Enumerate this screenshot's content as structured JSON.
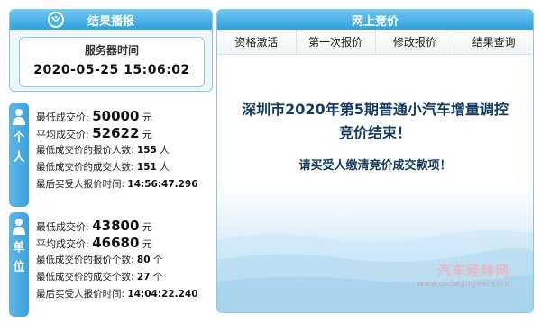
{
  "result_panel": {
    "title": "结果播报",
    "server_time_label": "服务器时间",
    "server_time": "2020-05-25 15:06:02"
  },
  "individual": {
    "tab_label": [
      "个",
      "人"
    ],
    "min_price_label": "最低成交价:",
    "min_price": "50000",
    "min_price_unit": "元",
    "avg_price_label": "平均成交价:",
    "avg_price": "52622",
    "avg_price_unit": "元",
    "min_price_bidders_label": "最低成交价的报价人数:",
    "min_price_bidders": "155",
    "min_price_bidders_unit": "人",
    "min_price_winners_label": "最低成交价的成交人数:",
    "min_price_winners": "151",
    "min_price_winners_unit": "人",
    "last_bid_time_label": "最后买受人报价时间:",
    "last_bid_time": "14:56:47.296"
  },
  "unit": {
    "tab_label": [
      "单",
      "位"
    ],
    "min_price_label": "最低成交价:",
    "min_price": "43800",
    "min_price_unit": "元",
    "avg_price_label": "平均成交价:",
    "avg_price": "46680",
    "avg_price_unit": "元",
    "min_price_bidders_label": "最低成交价的报价个数:",
    "min_price_bidders": "80",
    "min_price_bidders_unit": "个",
    "min_price_winners_label": "最低成交价的成交个数:",
    "min_price_winners": "27",
    "min_price_winners_unit": "个",
    "last_bid_time_label": "最后买受人报价时间:",
    "last_bid_time": "14:04:22.240"
  },
  "online_bidding": {
    "title": "网上竞价",
    "tabs": [
      "资格激活",
      "第一次报价",
      "修改报价",
      "结果查询"
    ],
    "message_line1": "深圳市2020年第5期普通小汽车增量调控",
    "message_line2": "竞价结束！",
    "message_line3": "请买受人缴清竞价成交款项！"
  },
  "watermark": {
    "brand": "汽车经纬网",
    "url": "www.qichejingwei.com"
  },
  "colors": {
    "header_blue": "#2ea2de",
    "tab_blue": "#3aa0dc",
    "message_text": "#123a5e"
  }
}
